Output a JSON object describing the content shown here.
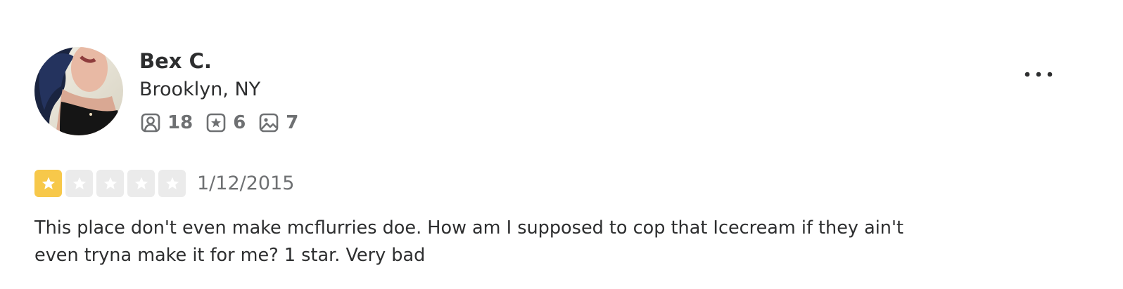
{
  "review": {
    "user": {
      "name": "Bex C.",
      "location": "Brooklyn, NY",
      "stats": {
        "friends": {
          "icon": "friends-icon",
          "value": "18"
        },
        "reviews": {
          "icon": "review-star-icon",
          "value": "6"
        },
        "photos": {
          "icon": "photo-icon",
          "value": "7"
        }
      }
    },
    "rating": {
      "value": 1,
      "max": 5,
      "filled_color": "#f7c84a",
      "empty_color": "#ebebeb"
    },
    "date": "1/12/2015",
    "text": "This place don't even make mcflurries doe. How am I supposed to cop that Icecream if they ain't even tryna make it for me? 1 star. Very bad",
    "more_icon": "more-options-icon"
  }
}
